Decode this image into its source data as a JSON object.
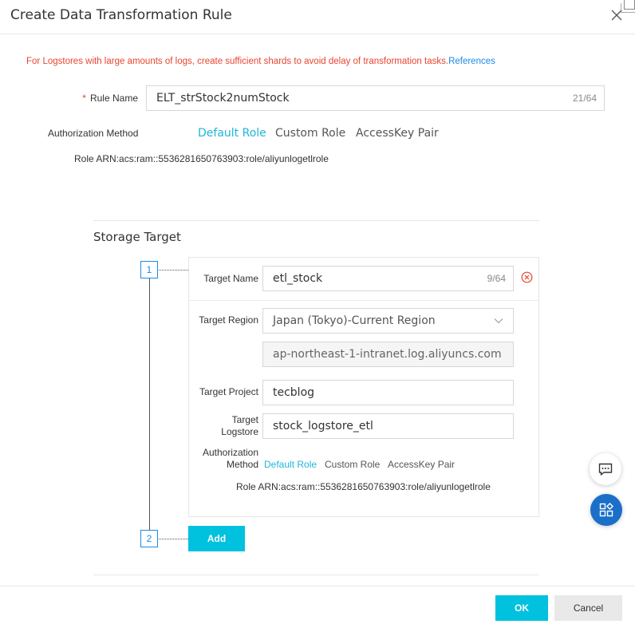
{
  "dialog": {
    "title": "Create Data Transformation Rule"
  },
  "warning": {
    "text": "For Logstores with large amounts of logs, create sufficient shards to avoid delay of transformation tasks.",
    "link": "References"
  },
  "rule_name": {
    "label": "Rule Name",
    "value": "ELT_strStock2numStock",
    "counter": "21/64"
  },
  "authorization": {
    "label": "Authorization Method",
    "tabs": [
      "Default Role",
      "Custom Role",
      "AccessKey Pair"
    ],
    "active_tab": "Default Role",
    "role_arn": "Role ARN:acs:ram::5536281650763903:role/aliyunlogetlrole"
  },
  "storage_target": {
    "title": "Storage Target",
    "steps": [
      "1",
      "2"
    ],
    "target": {
      "name_label": "Target Name",
      "name_value": "etl_stock",
      "name_counter": "9/64",
      "region_label": "Target Region",
      "region_value": "Japan (Tokyo)-Current Region",
      "endpoint_value": "ap-northeast-1-intranet.log.aliyuncs.com",
      "project_label": "Target Project",
      "project_value": "tecblog",
      "logstore_label_line1": "Target",
      "logstore_label_line2": "Logstore",
      "logstore_value": "stock_logstore_etl",
      "auth_label_line1": "Authorization",
      "auth_label_line2": "Method",
      "auth_tabs": [
        "Default Role",
        "Custom Role",
        "AccessKey Pair"
      ],
      "auth_active_tab": "Default Role",
      "role_arn": "Role ARN:acs:ram::5536281650763903:role/aliyunlogetlrole"
    },
    "add_label": "Add"
  },
  "footer": {
    "ok_label": "OK",
    "cancel_label": "Cancel"
  },
  "icons": {
    "close": "close-icon",
    "delete": "circle-x-icon",
    "chevron": "chevron-down-icon",
    "chat": "chat-icon",
    "apps": "apps-grid-icon"
  },
  "colors": {
    "accent": "#00c1de",
    "active_tab": "#1fb6d8",
    "warning": "#e8442f",
    "link": "#1b8ae6",
    "float_apps": "#1b6fc9"
  }
}
